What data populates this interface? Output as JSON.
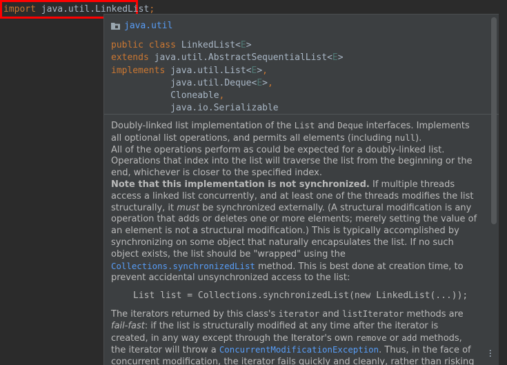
{
  "editor": {
    "import_kw": "import",
    "import_path": "java.util.LinkedList",
    "semicolon": ";"
  },
  "popup": {
    "package": "java.util",
    "signature": {
      "public_class_kw": "public class",
      "class_name": "LinkedList",
      "type_param": "E",
      "extends_kw": "extends",
      "extends_type": "java.util.AbstractSequentialList",
      "implements_kw": "implements",
      "iface1": "java.util.List",
      "iface2": "java.util.Deque",
      "iface3": "Cloneable",
      "iface4": "java.io.Serializable"
    },
    "doc": {
      "p1_a": "Doubly-linked list implementation of the ",
      "p1_list": "List",
      "p1_b": " and ",
      "p1_deque": "Deque",
      "p1_c": " interfaces. Implements all optional list operations, and permits all elements (including ",
      "p1_null": "null",
      "p1_d": ").",
      "p2": "All of the operations perform as could be expected for a doubly-linked list. Operations that index into the list will traverse the list from the beginning or the end, whichever is closer to the specified index.",
      "p3_bold": "Note that this implementation is not synchronized.",
      "p3_a": " If multiple threads access a linked list concurrently, and at least one of the threads modifies the list structurally, it ",
      "p3_must": "must",
      "p3_b": " be synchronized externally. (A structural modification is any operation that adds or deletes one or more elements; merely setting the value of an element is not a structural modification.) This is typically accomplished by synchronizing on some object that naturally encapsulates the list. If no such object exists, the list should be \"wrapped\" using the ",
      "p3_link": "Collections.synchronizedList",
      "p3_c": " method. This is best done at creation time, to prevent accidental unsynchronized access to the list:",
      "code": "List list = Collections.synchronizedList(new LinkedList(...));",
      "p4_a": "The iterators returned by this class's ",
      "p4_iterator": "iterator",
      "p4_b": " and ",
      "p4_listIterator": "listIterator",
      "p4_c": " methods are ",
      "p4_failfast": "fail-fast",
      "p4_d": ": if the list is structurally modified at any time after the iterator is created, in any way except through the Iterator's own ",
      "p4_remove": "remove",
      "p4_e": " or ",
      "p4_add": "add",
      "p4_f": " methods, the iterator will throw a ",
      "p4_link": "ConcurrentModificationException",
      "p4_g": ". Thus, in the face of concurrent modification, the iterator fails quickly and cleanly, rather than risking arbitrary, non-deterministic behavior at an undetermined time in the future."
    },
    "more_icon": "more-vertical-icon"
  }
}
